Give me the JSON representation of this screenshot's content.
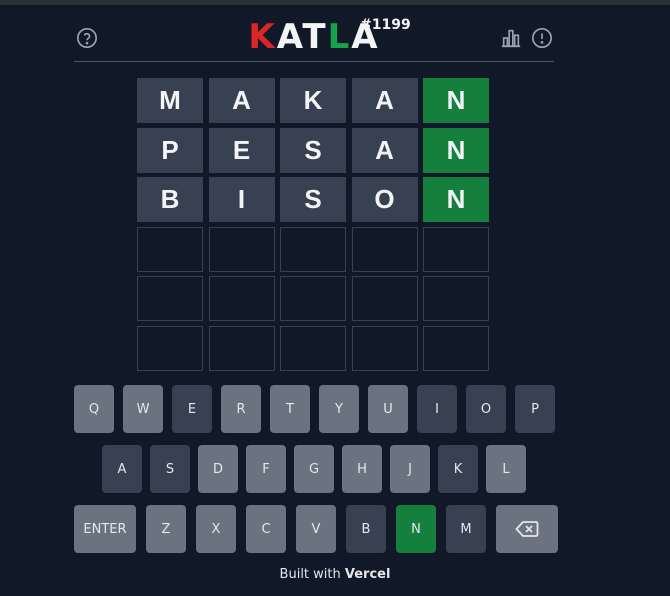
{
  "header": {
    "title_letters": [
      {
        "char": "K",
        "color": "#dc2626"
      },
      {
        "char": "A",
        "color": "#f3f4f6"
      },
      {
        "char": "T",
        "color": "#f3f4f6"
      },
      {
        "char": "L",
        "color": "#16a34a"
      },
      {
        "char": "A",
        "color": "#f3f4f6"
      }
    ],
    "puzzle_number": "#1199",
    "icons": {
      "help": "help-circle-icon",
      "stats": "bar-chart-icon",
      "info": "info-circle-icon"
    }
  },
  "board": {
    "rows": [
      [
        {
          "letter": "M",
          "state": "absent"
        },
        {
          "letter": "A",
          "state": "absent"
        },
        {
          "letter": "K",
          "state": "absent"
        },
        {
          "letter": "A",
          "state": "absent"
        },
        {
          "letter": "N",
          "state": "correct"
        }
      ],
      [
        {
          "letter": "P",
          "state": "absent"
        },
        {
          "letter": "E",
          "state": "absent"
        },
        {
          "letter": "S",
          "state": "absent"
        },
        {
          "letter": "A",
          "state": "absent"
        },
        {
          "letter": "N",
          "state": "correct"
        }
      ],
      [
        {
          "letter": "B",
          "state": "absent"
        },
        {
          "letter": "I",
          "state": "absent"
        },
        {
          "letter": "S",
          "state": "absent"
        },
        {
          "letter": "O",
          "state": "absent"
        },
        {
          "letter": "N",
          "state": "correct"
        }
      ],
      [
        {
          "letter": "",
          "state": "empty"
        },
        {
          "letter": "",
          "state": "empty"
        },
        {
          "letter": "",
          "state": "empty"
        },
        {
          "letter": "",
          "state": "empty"
        },
        {
          "letter": "",
          "state": "empty"
        }
      ],
      [
        {
          "letter": "",
          "state": "empty"
        },
        {
          "letter": "",
          "state": "empty"
        },
        {
          "letter": "",
          "state": "empty"
        },
        {
          "letter": "",
          "state": "empty"
        },
        {
          "letter": "",
          "state": "empty"
        }
      ],
      [
        {
          "letter": "",
          "state": "empty"
        },
        {
          "letter": "",
          "state": "empty"
        },
        {
          "letter": "",
          "state": "empty"
        },
        {
          "letter": "",
          "state": "empty"
        },
        {
          "letter": "",
          "state": "empty"
        }
      ]
    ]
  },
  "keyboard": {
    "rows": [
      [
        {
          "label": "Q",
          "state": "unused"
        },
        {
          "label": "W",
          "state": "unused"
        },
        {
          "label": "E",
          "state": "absent"
        },
        {
          "label": "R",
          "state": "unused"
        },
        {
          "label": "T",
          "state": "unused"
        },
        {
          "label": "Y",
          "state": "unused"
        },
        {
          "label": "U",
          "state": "unused"
        },
        {
          "label": "I",
          "state": "absent"
        },
        {
          "label": "O",
          "state": "absent"
        },
        {
          "label": "P",
          "state": "absent"
        }
      ],
      [
        {
          "label": "A",
          "state": "absent"
        },
        {
          "label": "S",
          "state": "absent"
        },
        {
          "label": "D",
          "state": "unused"
        },
        {
          "label": "F",
          "state": "unused"
        },
        {
          "label": "G",
          "state": "unused"
        },
        {
          "label": "H",
          "state": "unused"
        },
        {
          "label": "J",
          "state": "unused"
        },
        {
          "label": "K",
          "state": "absent"
        },
        {
          "label": "L",
          "state": "unused"
        }
      ],
      [
        {
          "label": "ENTER",
          "state": "unused",
          "wide": true
        },
        {
          "label": "Z",
          "state": "unused"
        },
        {
          "label": "X",
          "state": "unused"
        },
        {
          "label": "C",
          "state": "unused"
        },
        {
          "label": "V",
          "state": "unused"
        },
        {
          "label": "B",
          "state": "absent"
        },
        {
          "label": "N",
          "state": "correct"
        },
        {
          "label": "M",
          "state": "absent"
        },
        {
          "label": "",
          "state": "unused",
          "wide": true,
          "icon": "backspace-icon"
        }
      ]
    ]
  },
  "footer": {
    "prefix": "Built with ",
    "brand": "Vercel"
  }
}
